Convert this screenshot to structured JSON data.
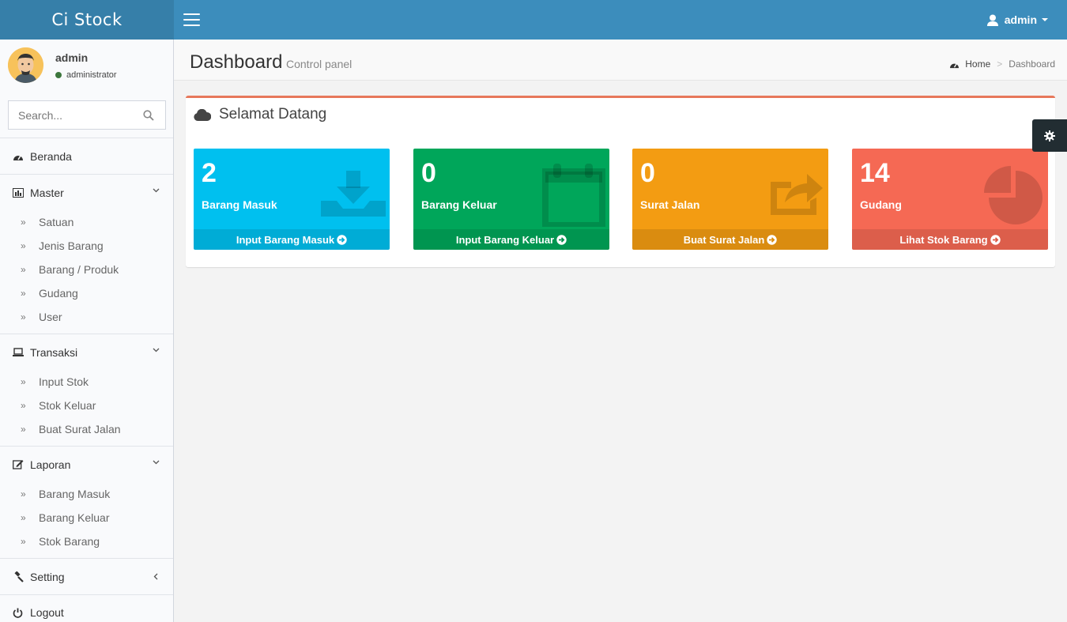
{
  "header": {
    "logo": "Ci Stock",
    "user_name": "admin"
  },
  "user_panel": {
    "name": "admin",
    "role": "administrator"
  },
  "search": {
    "placeholder": "Search..."
  },
  "menu": {
    "beranda": "Beranda",
    "master": {
      "label": "Master",
      "items": [
        "Satuan",
        "Jenis Barang",
        "Barang / Produk",
        "Gudang",
        "User"
      ]
    },
    "transaksi": {
      "label": "Transaksi",
      "items": [
        "Input Stok",
        "Stok Keluar",
        "Buat Surat Jalan"
      ]
    },
    "laporan": {
      "label": "Laporan",
      "items": [
        "Barang Masuk",
        "Barang Keluar",
        "Stok Barang"
      ]
    },
    "setting": "Setting",
    "logout": "Logout"
  },
  "page": {
    "title": "Dashboard",
    "subtitle": "Control panel",
    "breadcrumb": [
      "Home",
      "Dashboard"
    ]
  },
  "box": {
    "title": "Selamat Datang",
    "tiles": [
      {
        "value": "2",
        "label": "Barang Masuk",
        "link": "Input Barang Masuk",
        "color": "#00c0ef",
        "icon": "download-tray-icon"
      },
      {
        "value": "0",
        "label": "Barang Keluar",
        "link": "Input Barang Keluar",
        "color": "#00a65a",
        "icon": "calendar-icon"
      },
      {
        "value": "0",
        "label": "Surat Jalan",
        "link": "Buat Surat Jalan",
        "color": "#f39c12",
        "icon": "share-icon"
      },
      {
        "value": "14",
        "label": "Gudang",
        "link": "Lihat Stok Barang",
        "color": "#f56954",
        "icon": "pie-chart-icon"
      }
    ]
  },
  "colors": {
    "header": "#3c8dbc",
    "logo": "#367fa9",
    "box_border": "#e7785b"
  }
}
